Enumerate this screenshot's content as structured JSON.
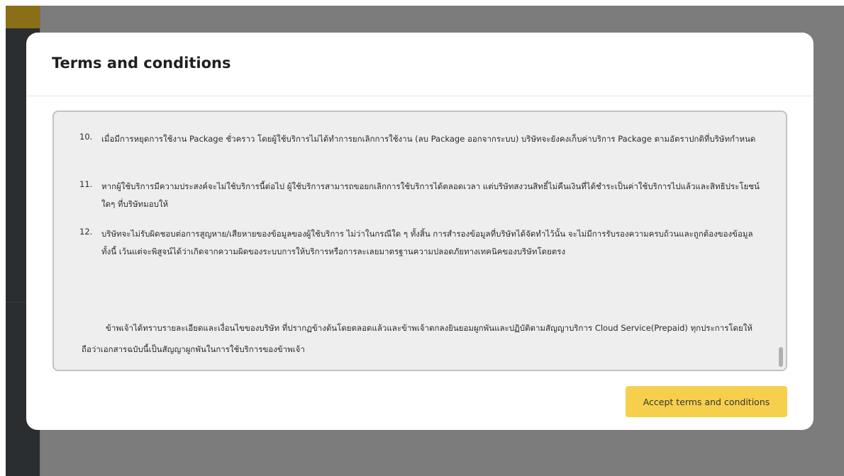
{
  "modal": {
    "title": "Terms and conditions",
    "accept_label": "Accept terms and conditions",
    "accent_color": "#f6d04d"
  },
  "terms": {
    "items": [
      {
        "number": "10.",
        "text": "เมื่อมีการหยุดการใช้งาน Package ชั่วคราว โดยผู้ใช้บริการไม่ได้ทำการยกเลิกการใช้งาน (ลบ Package ออกจากระบบ) บริษัทจะยังคงเก็บค่าบริการ Package ตามอัตราปกติที่บริษัทกำหนด"
      },
      {
        "number": "11.",
        "text": "หากผู้ใช้บริการมีความประสงค์จะไม่ใช้บริการนี้ต่อไป ผู้ใช้บริการสามารถขอยกเลิกการใช้บริการได้ตลอดเวลา แต่บริษัทสงวนสิทธิ์ไม่คืนเงินที่ได้ชำระเป็นค่าใช้บริการไปแล้วและสิทธิประโยชน์ใดๆ ที่บริษัทมอบให้"
      },
      {
        "number": "12.",
        "text": "บริษัทจะไม่รับผิดชอบต่อการสูญหาย/เสียหายของข้อมูลของผู้ใช้บริการ ไม่ว่าในกรณีใด ๆ ทั้งสิ้น การสำรองข้อมูลที่บริษัทได้จัดทำไว้นั้น จะไม่มีการรับรองความครบถ้วนและถูกต้องของข้อมูล ทั้งนี้ เว้นแต่จะพิสูจน์ได้ว่าเกิดจากความผิดของระบบการให้บริการหรือการละเลยมาตรฐานความปลอดภัยทางเทคนิคของบริษัทโดยตรง"
      }
    ],
    "closing": "ข้าพเจ้าได้ทราบรายละเอียดและเงื่อนไขของบริษัท ที่ปรากฏข้างต้นโดยตลอดแล้วและข้าพเจ้าตกลงยินยอมผูกพันและปฏิบัติตามสัญญาบริการ Cloud Service(Prepaid) ทุกประการโดยให้ถือว่าเอกสารฉบับนี้เป็นสัญญาผูกพันในการใช้บริการของข้าพเจ้า"
  }
}
